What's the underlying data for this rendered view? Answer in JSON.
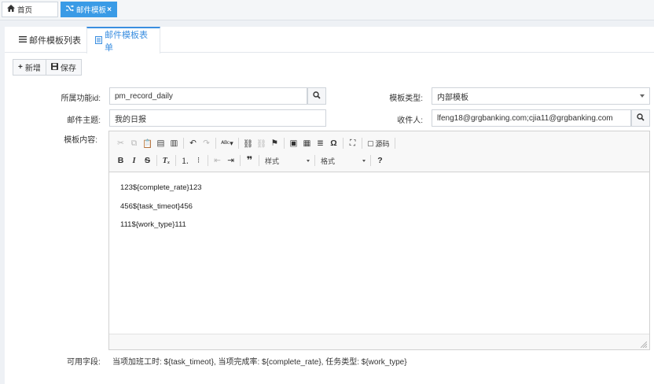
{
  "top_tabs": [
    {
      "label": "首页",
      "icon": "home-icon"
    },
    {
      "label": "邮件模板",
      "icon": "shuffle-icon",
      "close": "×"
    }
  ],
  "sub_tabs": [
    {
      "label": "邮件模板列表",
      "icon": "list-icon"
    },
    {
      "label": "邮件模板表单",
      "icon": "form-icon"
    }
  ],
  "toolbar": {
    "add_label": "新增",
    "add_icon": "+",
    "save_label": "保存"
  },
  "form": {
    "function_id": {
      "label": "所属功能id:",
      "value": "pm_record_daily"
    },
    "template_type": {
      "label": "模板类型:",
      "value": "内部模板"
    },
    "subject": {
      "label": "邮件主题:",
      "value": "我的日报"
    },
    "recipients": {
      "label": "收件人:",
      "value": "lfeng18@grgbanking.com;cjia11@grgbanking.com"
    },
    "content_label": "模板内容:"
  },
  "editor": {
    "style_combo": "样式",
    "format_combo": "格式",
    "source_label": "源码",
    "lines": [
      "123${complete_rate}123",
      "456${task_timeot}456",
      "111${work_type}111"
    ]
  },
  "available_fields": {
    "label": "可用字段:",
    "text": "当项加班工时: ${task_timeot}, 当项完成率: ${complete_rate}, 任务类型: ${work_type}"
  },
  "colors": {
    "accent": "#3a9be6",
    "tab_active": "#3a8ee0"
  }
}
